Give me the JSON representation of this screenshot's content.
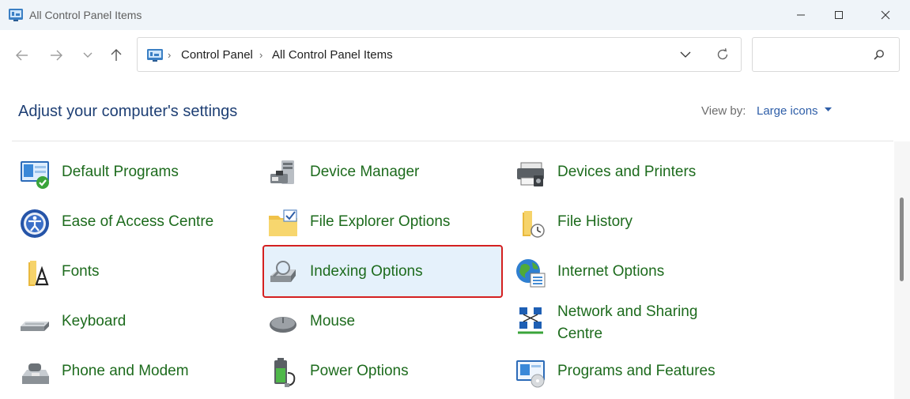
{
  "window": {
    "title": "All Control Panel Items"
  },
  "addressbar": {
    "breadcrumbs": [
      "Control Panel",
      "All Control Panel Items"
    ],
    "search_placeholder": ""
  },
  "content": {
    "heading": "Adjust your computer's settings",
    "view_by_label": "View by:",
    "view_by_value": "Large icons",
    "items": [
      {
        "label": "Default Programs",
        "icon": "default-programs-icon"
      },
      {
        "label": "Device Manager",
        "icon": "device-manager-icon"
      },
      {
        "label": "Devices and Printers",
        "icon": "devices-printers-icon"
      },
      {
        "label": "Ease of Access Centre",
        "icon": "ease-of-access-icon"
      },
      {
        "label": "File Explorer Options",
        "icon": "file-explorer-options-icon"
      },
      {
        "label": "File History",
        "icon": "file-history-icon"
      },
      {
        "label": "Fonts",
        "icon": "fonts-icon"
      },
      {
        "label": "Indexing Options",
        "icon": "indexing-options-icon",
        "selected": true
      },
      {
        "label": "Internet Options",
        "icon": "internet-options-icon"
      },
      {
        "label": "Keyboard",
        "icon": "keyboard-icon"
      },
      {
        "label": "Mouse",
        "icon": "mouse-icon"
      },
      {
        "label": "Network and Sharing Centre",
        "icon": "network-sharing-icon"
      },
      {
        "label": "Phone and Modem",
        "icon": "phone-modem-icon"
      },
      {
        "label": "Power Options",
        "icon": "power-options-icon"
      },
      {
        "label": "Programs and Features",
        "icon": "programs-features-icon"
      }
    ]
  },
  "colors": {
    "link_green": "#1d6b1d",
    "heading_blue": "#1e3f74",
    "selection_border": "#d42020",
    "selection_fill": "#e5f1fb"
  }
}
